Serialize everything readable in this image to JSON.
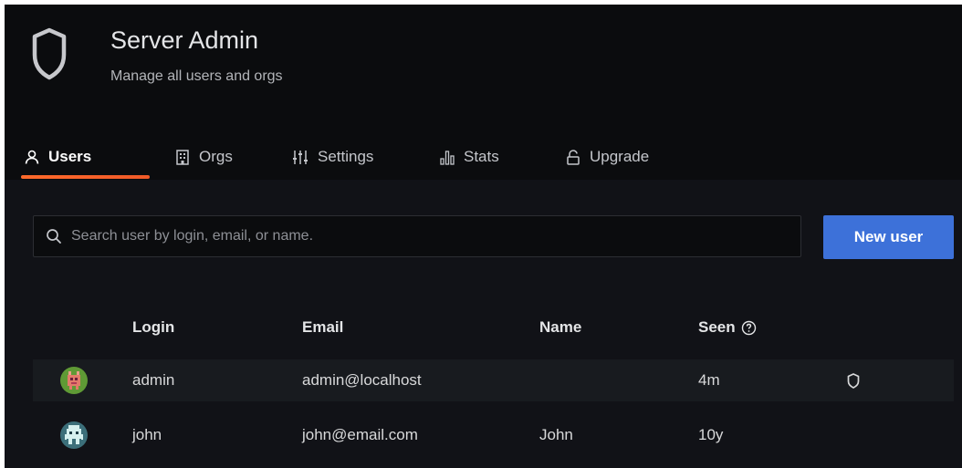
{
  "header": {
    "title": "Server Admin",
    "subtitle": "Manage all users and orgs",
    "icon": "shield-icon"
  },
  "tabs": [
    {
      "label": "Users",
      "icon": "user-icon",
      "active": true
    },
    {
      "label": "Orgs",
      "icon": "building-icon",
      "active": false
    },
    {
      "label": "Settings",
      "icon": "sliders-icon",
      "active": false
    },
    {
      "label": "Stats",
      "icon": "bar-chart-icon",
      "active": false
    },
    {
      "label": "Upgrade",
      "icon": "unlock-icon",
      "active": false
    }
  ],
  "search": {
    "placeholder": "Search user by login, email, or name.",
    "value": ""
  },
  "new_user_label": "New user",
  "table": {
    "headers": {
      "login": "Login",
      "email": "Email",
      "name": "Name",
      "seen": "Seen"
    },
    "rows": [
      {
        "login": "admin",
        "email": "admin@localhost",
        "name": "",
        "seen": "4m",
        "is_admin": true
      },
      {
        "login": "john",
        "email": "john@email.com",
        "name": "John",
        "seen": "10y",
        "is_admin": false
      }
    ]
  },
  "colors": {
    "background": "#111217",
    "header_background": "#0b0c0e",
    "accent_underline": "#ff6a2b",
    "primary_button": "#3d71d9",
    "row_highlight": "#181b1f"
  }
}
